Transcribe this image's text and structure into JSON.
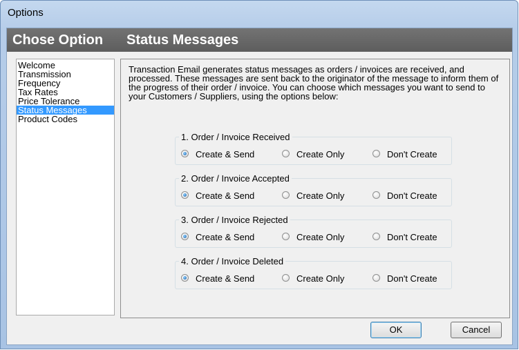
{
  "window": {
    "title": "Options"
  },
  "header": {
    "left": "Chose Option",
    "right": "Status Messages"
  },
  "nav": {
    "items": [
      "Welcome",
      "Transmission",
      "Frequency",
      "Tax Rates",
      "Price Tolerance",
      "Status Messages",
      "Product Codes"
    ],
    "selected": "Status Messages"
  },
  "description": {
    "lines": [
      "Transaction Email generates status messages as orders / invoices are received, and",
      "processed. These messages are sent back to the originator of the message to inform them of",
      "the progress of their order / invoice. You can choose which messages you want to send to",
      "your Customers / Suppliers, using the options below:"
    ]
  },
  "groups": [
    {
      "legend": "1. Order / Invoice Received",
      "options": [
        "Create & Send",
        "Create Only",
        "Don't Create"
      ],
      "selected": "Create & Send"
    },
    {
      "legend": "2. Order / Invoice Accepted",
      "options": [
        "Create & Send",
        "Create Only",
        "Don't Create"
      ],
      "selected": "Create & Send"
    },
    {
      "legend": "3. Order / Invoice Rejected",
      "options": [
        "Create & Send",
        "Create Only",
        "Don't Create"
      ],
      "selected": "Create & Send"
    },
    {
      "legend": "4. Order / Invoice Deleted",
      "options": [
        "Create & Send",
        "Create Only",
        "Don't Create"
      ],
      "selected": "Create & Send"
    }
  ],
  "buttons": {
    "ok": "OK",
    "cancel": "Cancel"
  }
}
